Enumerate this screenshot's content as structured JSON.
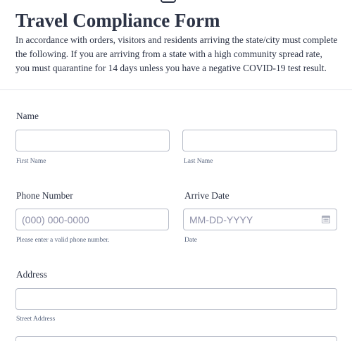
{
  "form": {
    "title": "Travel Compliance Form",
    "description": "In accordance with orders, visitors and residents arriving the state/city must complete the following. If you are arriving from a state with a high community spread rate, you must quarantine for 14 days unless you have a negative COVID-19 test result."
  },
  "name": {
    "label": "Name",
    "first_value": "",
    "last_value": "",
    "first_sublabel": "First Name",
    "last_sublabel": "Last Name"
  },
  "phone": {
    "label": "Phone Number",
    "placeholder": "(000) 000-0000",
    "value": "",
    "sublabel": "Please enter a valid phone number."
  },
  "arrive": {
    "label": "Arrive Date",
    "placeholder": "MM-DD-YYYY",
    "value": "",
    "sublabel": "Date",
    "icon": "calendar-icon"
  },
  "address": {
    "label": "Address",
    "street_value": "",
    "street_sublabel": "Street Address"
  },
  "colors": {
    "text": "#2c3345",
    "border": "#b8bdc9",
    "placeholder": "#8d8fa8",
    "divider": "#e3e5ea"
  }
}
